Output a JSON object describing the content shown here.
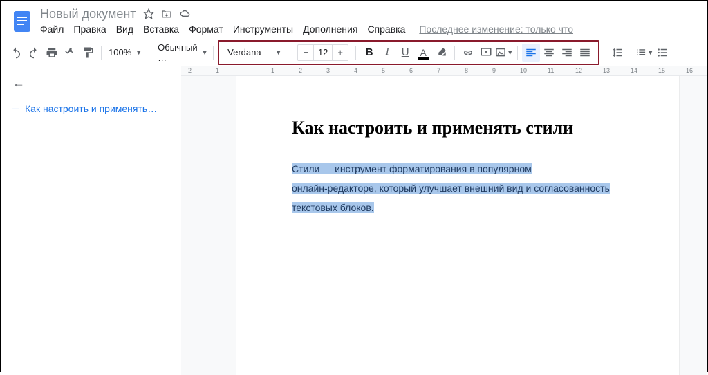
{
  "header": {
    "doc_title": "Новый документ",
    "menu": {
      "file": "Файл",
      "edit": "Правка",
      "view": "Вид",
      "insert": "Вставка",
      "format": "Формат",
      "tools": "Инструменты",
      "addons": "Дополнения",
      "help": "Справка"
    },
    "last_edit": "Последнее изменение: только что"
  },
  "toolbar": {
    "zoom": "100%",
    "style": "Обычный …",
    "font": "Verdana",
    "size": "12"
  },
  "outline": {
    "item1": "Как настроить и применять…"
  },
  "document": {
    "heading": "Как настроить и применять стили",
    "p1a": "Стили — инструмент форматирования в популярном",
    "p1b": "онлайн-редакторе, который улучшает внешний вид и согласованность",
    "p1c": "текстовых блоков."
  },
  "ruler": {
    "m2": "2",
    "m1": "1",
    "n1": "1",
    "n2": "2",
    "n3": "3",
    "n4": "4",
    "n5": "5",
    "n6": "6",
    "n7": "7",
    "n8": "8",
    "n9": "9",
    "n10": "10",
    "n11": "11",
    "n12": "12",
    "n13": "13",
    "n14": "14",
    "n15": "15",
    "n16": "16"
  }
}
